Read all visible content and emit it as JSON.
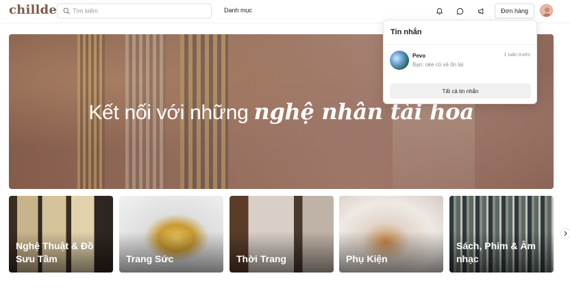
{
  "header": {
    "logo": "chillde",
    "search_placeholder": "Tìm kiếm",
    "nav_category": "Danh mục",
    "orders_label": "Đơn hàng"
  },
  "hero": {
    "text_plain": "Kết nối với những ",
    "text_emphasis": "nghệ nhân tài hoa"
  },
  "categories": [
    {
      "label": "Nghệ Thuật & Đồ Sưu Tầm"
    },
    {
      "label": "Trang Sức"
    },
    {
      "label": "Thời Trang"
    },
    {
      "label": "Phụ Kiện"
    },
    {
      "label": "Sách, Phim & Âm nhạc"
    }
  ],
  "messages": {
    "title": "Tin nhắn",
    "items": [
      {
        "name": "Pevo",
        "time": "1 tuần trước",
        "preview": "Bạn: oke có vẻ ổn lại"
      }
    ],
    "view_all": "Tất cả tin nhắn"
  },
  "colors": {
    "logo": "#7a5a4a",
    "hero_overlay": "#805246"
  }
}
